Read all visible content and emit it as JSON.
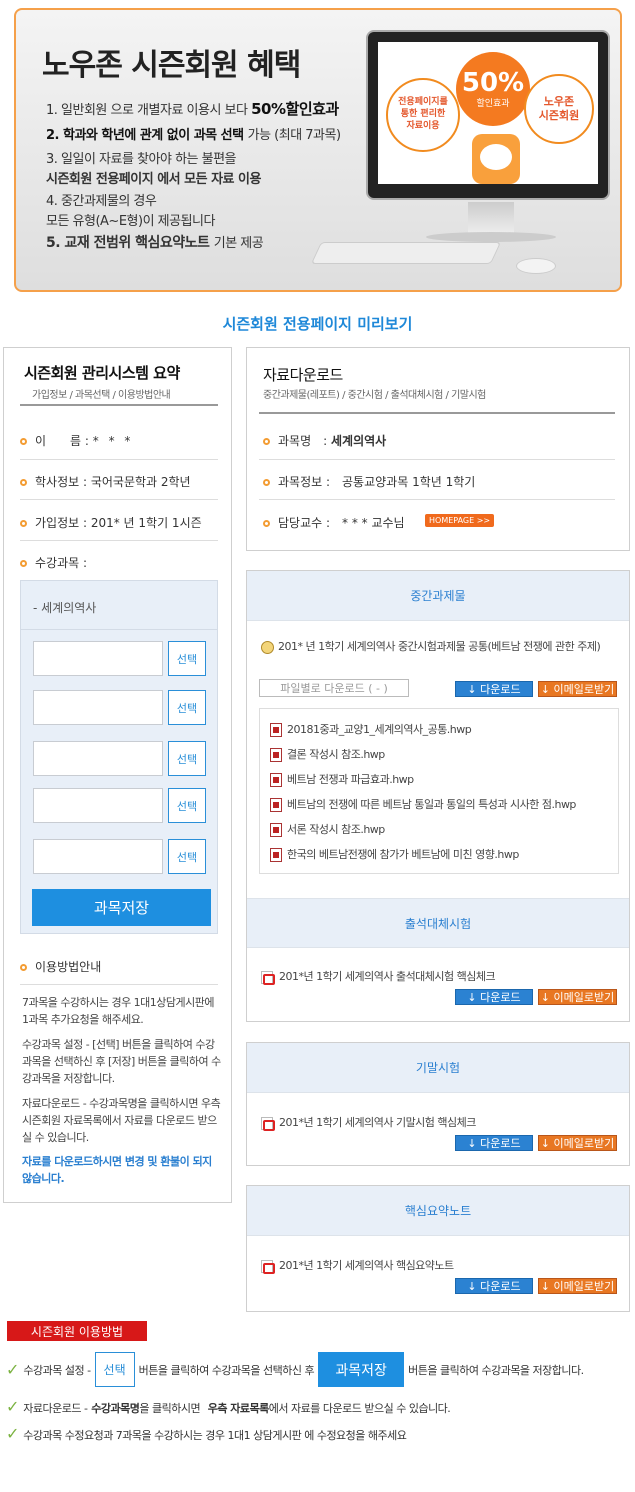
{
  "banner": {
    "title": "노우존 시즌회원 혜택",
    "benefits": [
      {
        "pre": "1. 일반회원 으로 개별자료 이용시 보다 ",
        "strong": "50%할인효과"
      },
      {
        "pre": "2. 학과와 학년에 관계 없이 과목 선택 ",
        "strong": "가능 (최대 7과목)"
      },
      {
        "pre": "3. 일일이 자료를 찾아야 하는 불편을",
        "strong": ""
      },
      {
        "pre": "   시즌회원 전용페이지 에서 모든 자료 이용",
        "strong": ""
      },
      {
        "pre": "4. 중간과제물의 경우",
        "strong": ""
      },
      {
        "pre": "   모든 유형(A~E형)이 제공됩니다",
        "strong": ""
      },
      {
        "pre": "5. 교재 전범위 핵심요약노트 ",
        "strong": "기본 제공"
      }
    ],
    "circle_left": "전용페이지를\n통한 편리한\n자료이용",
    "circle_pct": "50%",
    "circle_pct_sub": "할인효과",
    "circle_right": "노우존\n시즌회원"
  },
  "preview_title": "시즌회원 전용페이지 미리보기",
  "left": {
    "title": "시즌회원 관리시스템 요약",
    "subtitle": "가입정보 / 과목선택 / 이용방법안내",
    "name_label": "이　　름 :",
    "name_value": "* * *",
    "school_label": "학사정보 : 국어국문학과 2학년",
    "join_label": "가입정보 : 201* 년 1학기 1시즌",
    "courses_label": "수강과목 :",
    "current_course": "- 세계의역사",
    "select_label": "선택",
    "save_label": "과목저장",
    "guide_title": "이용방법안내",
    "guide1": "7과목을 수강하시는 경우 1대1상담게시판에 1과목 추가요청을 해주세요.",
    "guide2": "수강과목 설정 - [선택] 버튼을 클릭하여 수강과목을 선택하신 후 [저장] 버튼을 클릭하여 수강과목을 저장합니다.",
    "guide3": "자료다운로드 - 수강과목명을 클릭하시면 우측 시즌회원 자료목록에서 자료를 다운로드 받으실 수 있습니다.",
    "guide4": "자료를 다운로드하시면 변경 및 환불이 되지 않습니다."
  },
  "right": {
    "title": "자료다운로드",
    "subtitle": "중간과제물(레포트) / 중간시험 / 출석대체시험 / 기말시험",
    "course_label": "과목명　:",
    "course_value": "세계의역사",
    "info_label": "과목정보 :　공통교양과목 1학년 1학기",
    "prof_label": "담당교수 :　* * * 교수님",
    "homepage": "HOMEPAGE >>"
  },
  "midterm": {
    "header": "중간과제물",
    "item": "201* 년 1학기 세계의역사 중간시험과제물 공통(베트남 전쟁에 관한 주제)",
    "file_dropdown": "파일별로 다운로드 ( - )",
    "download": "↓ 다운로드",
    "email": "↓ 이메일로받기",
    "files": [
      "20181중과_교양1_세계의역사_공통.hwp",
      "결론 작성시 참조.hwp",
      "베트남 전쟁과 파급효과.hwp",
      "베트남의 전쟁에 따른 베트남 통일과 통일의 특성과 시사한 점.hwp",
      "서론 작성시 참조.hwp",
      "한국의 베트남전쟁에 참가가 베트남에 미친 영향.hwp"
    ]
  },
  "attendance": {
    "header": "출석대체시험",
    "item": "201*년 1학기 세계의역사 출석대체시험 핵심체크",
    "download": "↓ 다운로드",
    "email": "↓ 이메일로받기"
  },
  "final": {
    "header": "기말시험",
    "item": "201*년 1학기 세계의역사 기말시험 핵심체크",
    "download": "↓ 다운로드",
    "email": "↓ 이메일로받기"
  },
  "summary": {
    "header": "핵심요약노트",
    "item": "201*년 1학기 세계의역사 핵심요약노트",
    "download": "↓ 다운로드",
    "email": "↓ 이메일로받기"
  },
  "howto": {
    "title": "시즌회원 이용방법",
    "l1_a": "수강과목 설정 -",
    "l1_btn1": "선택",
    "l1_b": "버튼을 클릭하여 수강과목을 선택하신 후",
    "l1_btn2": "과목저장",
    "l1_c": "버튼을 클릭하여 수강과목을 저장합니다.",
    "l2_a": "자료다운로드 -",
    "l2_b": "수강과목명",
    "l2_c": "을 클릭하시면",
    "l2_d": "우측 자료목록",
    "l2_e": "에서 자료를 다운로드 받으실 수 있습니다.",
    "l3_a": "수강과목 수정요청과 7과목",
    "l3_b": "을 수강하시는 경우  1대1 상담게시판 에 수정요청을 해주세요"
  }
}
